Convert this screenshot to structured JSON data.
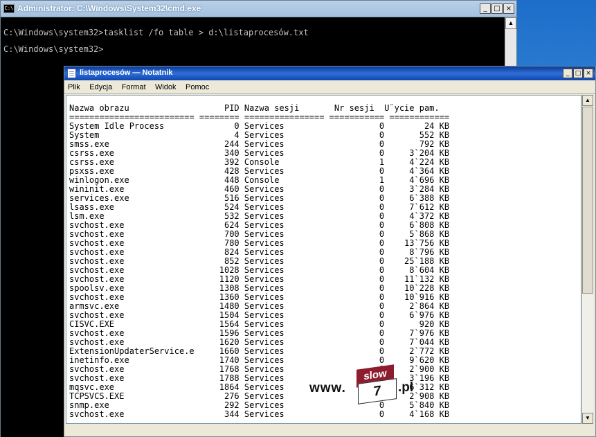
{
  "cmd": {
    "title": "Administrator: C:\\Windows\\System32\\cmd.exe",
    "icon_label": "C:\\",
    "lines": [
      "C:\\Windows\\system32>tasklist /fo table > d:\\listaprocesów.txt",
      "C:\\Windows\\system32>"
    ]
  },
  "notepad": {
    "title": "listaprocesów — Notatnik",
    "menu": [
      "Plik",
      "Edycja",
      "Format",
      "Widok",
      "Pomoc"
    ],
    "header": "Nazwa obrazu                   PID Nazwa sesji       Nr sesji  U¨ycie pam.",
    "separator": "========================= ======== ================ =========== ============",
    "rows": [
      [
        "System Idle Process",
        "0",
        "Services",
        "0",
        "24 KB"
      ],
      [
        "System",
        "4",
        "Services",
        "0",
        "552 KB"
      ],
      [
        "smss.exe",
        "244",
        "Services",
        "0",
        "792 KB"
      ],
      [
        "csrss.exe",
        "340",
        "Services",
        "0",
        "3`204 KB"
      ],
      [
        "csrss.exe",
        "392",
        "Console",
        "1",
        "4`224 KB"
      ],
      [
        "psxss.exe",
        "428",
        "Services",
        "0",
        "4`364 KB"
      ],
      [
        "winlogon.exe",
        "448",
        "Console",
        "1",
        "4`696 KB"
      ],
      [
        "wininit.exe",
        "460",
        "Services",
        "0",
        "3`284 KB"
      ],
      [
        "services.exe",
        "516",
        "Services",
        "0",
        "6`388 KB"
      ],
      [
        "lsass.exe",
        "524",
        "Services",
        "0",
        "7`612 KB"
      ],
      [
        "lsm.exe",
        "532",
        "Services",
        "0",
        "4`372 KB"
      ],
      [
        "svchost.exe",
        "624",
        "Services",
        "0",
        "6`808 KB"
      ],
      [
        "svchost.exe",
        "700",
        "Services",
        "0",
        "5`868 KB"
      ],
      [
        "svchost.exe",
        "780",
        "Services",
        "0",
        "13`756 KB"
      ],
      [
        "svchost.exe",
        "824",
        "Services",
        "0",
        "8`796 KB"
      ],
      [
        "svchost.exe",
        "852",
        "Services",
        "0",
        "25`188 KB"
      ],
      [
        "svchost.exe",
        "1028",
        "Services",
        "0",
        "8`604 KB"
      ],
      [
        "svchost.exe",
        "1120",
        "Services",
        "0",
        "11`132 KB"
      ],
      [
        "spoolsv.exe",
        "1308",
        "Services",
        "0",
        "10`228 KB"
      ],
      [
        "svchost.exe",
        "1360",
        "Services",
        "0",
        "10`916 KB"
      ],
      [
        "armsvc.exe",
        "1480",
        "Services",
        "0",
        "2`864 KB"
      ],
      [
        "svchost.exe",
        "1504",
        "Services",
        "0",
        "6`976 KB"
      ],
      [
        "CISVC.EXE",
        "1564",
        "Services",
        "0",
        "920 KB"
      ],
      [
        "svchost.exe",
        "1596",
        "Services",
        "0",
        "7`976 KB"
      ],
      [
        "svchost.exe",
        "1620",
        "Services",
        "0",
        "7`044 KB"
      ],
      [
        "ExtensionUpdaterService.e",
        "1660",
        "Services",
        "0",
        "2`772 KB"
      ],
      [
        "inetinfo.exe",
        "1740",
        "Services",
        "0",
        "9`620 KB"
      ],
      [
        "svchost.exe",
        "1768",
        "Services",
        "0",
        "2`900 KB"
      ],
      [
        "svchost.exe",
        "1788",
        "Services",
        "0",
        "3`196 KB"
      ],
      [
        "mqsvc.exe",
        "1864",
        "Services",
        "0",
        "6`312 KB"
      ],
      [
        "TCPSVCS.EXE",
        "276",
        "Services",
        "0",
        "2`908 KB"
      ],
      [
        "snmp.exe",
        "292",
        "Services",
        "0",
        "5`840 KB"
      ],
      [
        "svchost.exe",
        "344",
        "Services",
        "0",
        "4`168 KB"
      ]
    ]
  },
  "watermark": {
    "www": "www.",
    "slow": "slow",
    "seven": "7",
    "pl": ".pl"
  }
}
